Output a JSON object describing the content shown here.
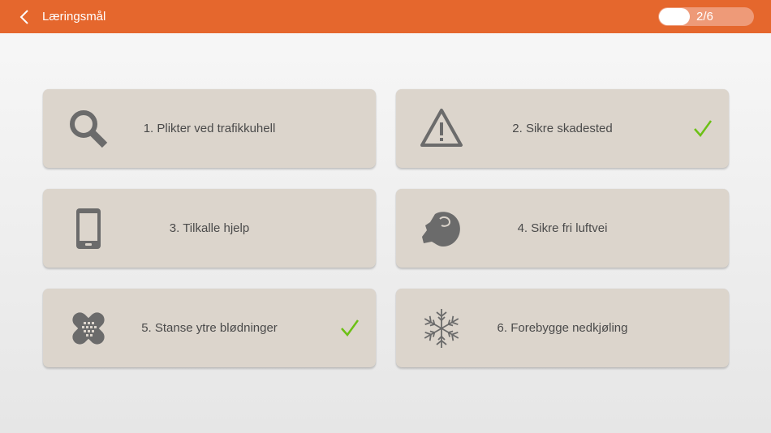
{
  "header": {
    "title": "Læringsmål",
    "back_icon": "chevron-left-icon",
    "progress": {
      "text": "2/6",
      "completed": 2,
      "total": 6
    }
  },
  "colors": {
    "header": "#e5672d",
    "card": "#dcd5cc",
    "icon": "#6b6b6b",
    "check": "#6cc015",
    "label": "#4a4a4a"
  },
  "goals": [
    {
      "label": "1. Plikter ved trafikkuhell",
      "icon": "magnifier-icon",
      "completed": false
    },
    {
      "label": "2. Sikre skadested",
      "icon": "warning-triangle-icon",
      "completed": true
    },
    {
      "label": "3. Tilkalle hjelp",
      "icon": "mobile-phone-icon",
      "completed": false
    },
    {
      "label": "4. Sikre fri luftvei",
      "icon": "head-airway-icon",
      "completed": false
    },
    {
      "label": "5. Stanse ytre blødninger",
      "icon": "bandage-icon",
      "completed": true
    },
    {
      "label": "6. Forebygge nedkjøling",
      "icon": "snowflake-icon",
      "completed": false
    }
  ]
}
